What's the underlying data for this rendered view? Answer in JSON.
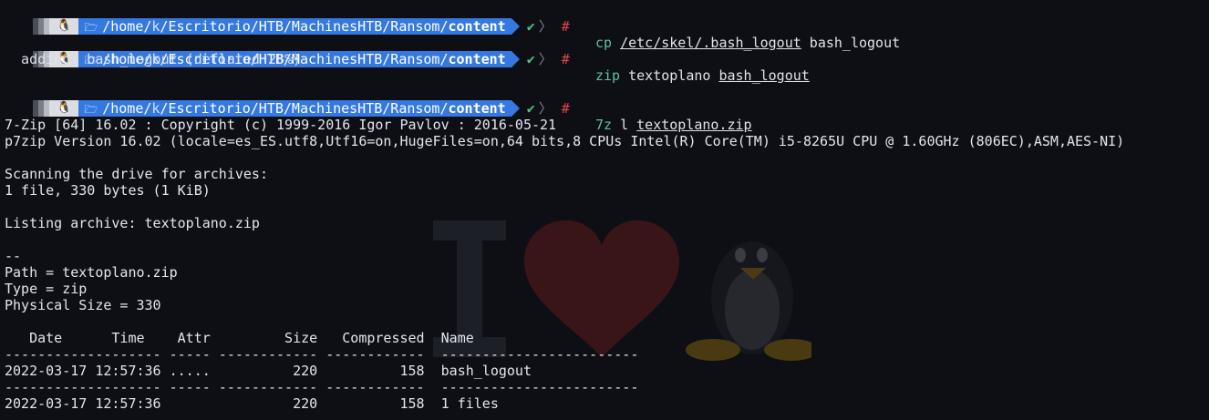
{
  "prompt": {
    "os_icon": "linux-tux-icon",
    "folder_icon": "folder-icon",
    "path_prefix": "/home/",
    "path_user": "k",
    "path_middle": "/Escritorio/HTB/MachinesHTB/Ransom/",
    "path_current": "content",
    "status_mark": "✔",
    "chevron": "〉",
    "root_hash": "#"
  },
  "commands": [
    {
      "name": "cp",
      "args_underlined": "/etc/skel/.bash_logout",
      "args_rest": " bash_logout"
    },
    {
      "name": "zip",
      "args_plain": " textoplano ",
      "args_underlined": "bash_logout"
    },
    {
      "name": "7z",
      "args_plain": " l ",
      "args_underlined": "textoplano.zip"
    }
  ],
  "output": {
    "zip_line": "  adding: bash_logout (deflated 28%)",
    "sz_header": "7-Zip [64] 16.02 : Copyright (c) 1999-2016 Igor Pavlov : 2016-05-21",
    "sz_version": "p7zip Version 16.02 (locale=es_ES.utf8,Utf16=on,HugeFiles=on,64 bits,8 CPUs Intel(R) Core(TM) i5-8265U CPU @ 1.60GHz (806EC),ASM,AES-NI)",
    "scanning": "Scanning the drive for archives:",
    "file_count": "1 file, 330 bytes (1 KiB)",
    "listing": "Listing archive: textoplano.zip",
    "sep": "--",
    "path_line": "Path = textoplano.zip",
    "type_line": "Type = zip",
    "phys_line": "Physical Size = 330",
    "table_header": "   Date      Time    Attr         Size   Compressed  Name",
    "table_rule": "------------------- ----- ------------ ------------  ------------------------",
    "row1": "2022-03-17 12:57:36 .....          220          158  bash_logout",
    "row_total": "2022-03-17 12:57:36                220          158  1 files"
  },
  "colors": {
    "background": "#0d0f14",
    "path_segment": "#3478e0",
    "ok": "#4cc38a",
    "root_hash": "#e0474c",
    "command": "#5fbf9f"
  }
}
